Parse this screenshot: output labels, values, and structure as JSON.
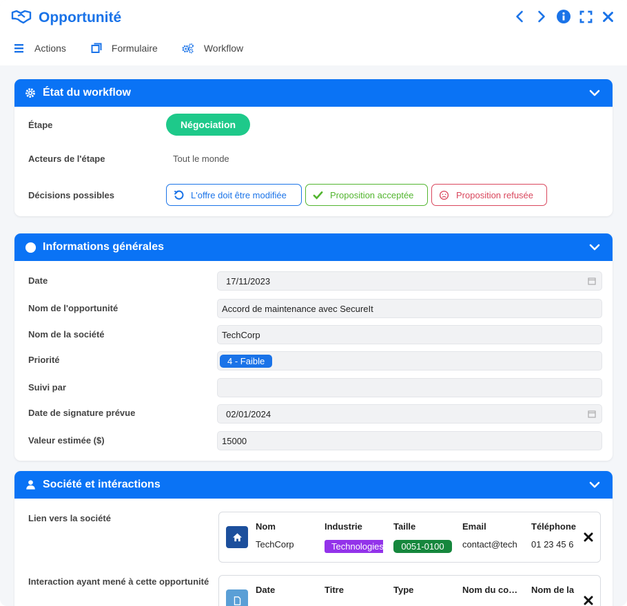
{
  "window": {
    "title": "Opportunité"
  },
  "menu": {
    "actions": "Actions",
    "form": "Formulaire",
    "workflow": "Workflow"
  },
  "workflow_section": {
    "title": "État du workflow",
    "step_label": "Étape",
    "step_value": "Négociation",
    "actors_label": "Acteurs de l'étape",
    "actors_value": "Tout le monde",
    "decisions_label": "Décisions possibles",
    "decisions": [
      {
        "label": "L'offre doit être modifiée",
        "color": "#1a73e8"
      },
      {
        "label": "Proposition acceptée",
        "color": "#52b52f"
      },
      {
        "label": "Proposition refusée",
        "color": "#d9465c"
      }
    ]
  },
  "general_section": {
    "title": "Informations générales",
    "date_label": "Date",
    "date_value": "17/11/2023",
    "name_label": "Nom de l'opportunité",
    "name_value": "Accord de maintenance avec SecureIt",
    "company_label": "Nom de la société",
    "company_value": "TechCorp",
    "priority_label": "Priorité",
    "priority_value": "4 - Faible",
    "followed_label": "Suivi par",
    "followed_value": "",
    "signdate_label": "Date de signature prévue",
    "signdate_value": "02/01/2024",
    "estimate_label": "Valeur estimée ($)",
    "estimate_value": "15000"
  },
  "company_section": {
    "title": "Société et intéractions",
    "company_link_label": "Lien vers la société",
    "company_link": {
      "headers": [
        "Nom",
        "Industrie",
        "Taille",
        "Email",
        "Téléphone"
      ],
      "values": [
        "TechCorp",
        "Technologies",
        "0051-0100",
        "contact@tech",
        "01 23 45 6"
      ]
    },
    "interaction_label": "Interaction ayant mené à cette opportunité",
    "interaction_link": {
      "headers": [
        "Date",
        "Titre",
        "Type",
        "Nom du co…",
        "Nom de la"
      ]
    }
  },
  "colors": {
    "accent": "#0a73f5",
    "success": "#1ec98a",
    "industry_tag": "#9333ea",
    "size_tag": "#16873d"
  }
}
